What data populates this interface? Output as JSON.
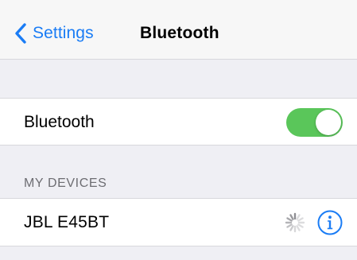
{
  "nav": {
    "back_label": "Settings",
    "title": "Bluetooth"
  },
  "bluetooth_row": {
    "label": "Bluetooth",
    "toggle_on": true
  },
  "devices_section": {
    "header": "MY DEVICES",
    "devices": [
      {
        "name": "JBL E45BT",
        "status_icon": "loading-spinner-icon",
        "action_icon": "info-icon"
      }
    ]
  },
  "colors": {
    "accent": "#1a7cf5",
    "toggle_on": "#5ac65a",
    "background": "#efeff4",
    "section_header": "#6d6d72"
  },
  "icons": {
    "back": "chevron-left-icon",
    "info": "info-icon",
    "spinner": "loading-spinner-icon"
  }
}
